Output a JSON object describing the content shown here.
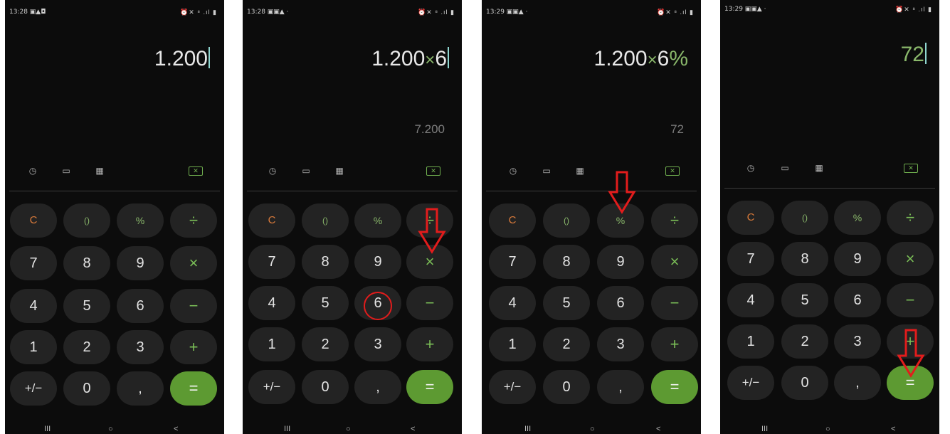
{
  "screens": [
    {
      "status_time": "13:28 ▣▲◘",
      "status_icons": "⏰✕ ⁸ .ıl ▮",
      "expression_number": "1.200",
      "expression_op": "",
      "expression_operand": "",
      "expression_pct": "",
      "preview": ""
    },
    {
      "status_time": "13:28 ▣▣▲ ·",
      "status_icons": "⏰✕ ⁸ .ıl ▮",
      "expression_number": "1.200",
      "expression_op": "×",
      "expression_operand": "6",
      "expression_pct": "",
      "preview": "7.200"
    },
    {
      "status_time": "13:29 ▣▣▲ ·",
      "status_icons": "⏰✕ ⁸ .ıl ▮",
      "expression_number": "1.200",
      "expression_op": "×",
      "expression_operand": "6",
      "expression_pct": "%",
      "preview": "72"
    },
    {
      "status_time": "13:29 ▣▣▲ ·",
      "status_icons": "⏰✕ ⁸ .ıl ▮",
      "expression_number": "72",
      "expression_op": "",
      "expression_operand": "",
      "expression_pct": "",
      "preview": ""
    }
  ],
  "toolbar": {
    "history_icon": "◷",
    "ruler_icon": "▭",
    "calc_icon": "▦",
    "backspace_icon": "✕"
  },
  "keys": {
    "clear": "C",
    "parens": "()",
    "percent": "%",
    "divide": "÷",
    "seven": "7",
    "eight": "8",
    "nine": "9",
    "multiply": "×",
    "four": "4",
    "five": "5",
    "six": "6",
    "minus": "−",
    "one": "1",
    "two": "2",
    "three": "3",
    "plus": "+",
    "negate": "+/−",
    "zero": "0",
    "comma": ",",
    "equals": "="
  },
  "nav": {
    "recents": "III",
    "home": "○",
    "back": "<"
  },
  "colors": {
    "background": "#0c0c0c",
    "key_bg": "#232323",
    "accent_green": "#5d9a32",
    "clear_orange": "#d97a3a",
    "annotation_red": "#e21c1c"
  }
}
